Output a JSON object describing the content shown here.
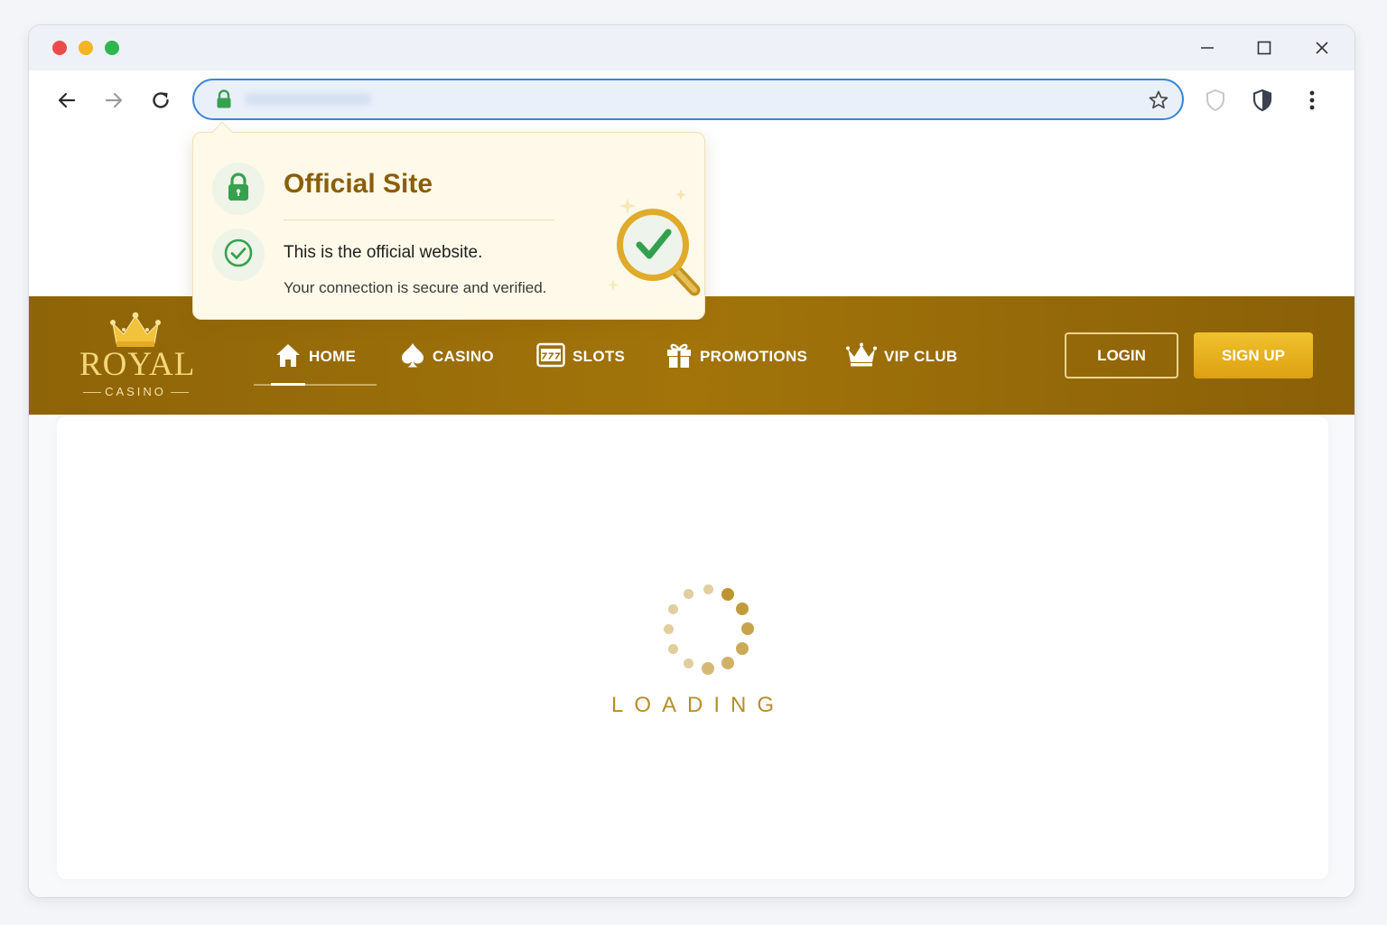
{
  "browser": {
    "controls": {
      "minimize": "minimize-icon",
      "maximize": "maximize-icon",
      "close": "close-icon"
    },
    "toolbar": {
      "back": "back-arrow-icon",
      "forward": "forward-arrow-icon",
      "reload": "reload-icon",
      "bookmark": "star-icon",
      "extension1": "shield-outline-icon",
      "extension2": "shield-half-icon",
      "menu": "kebab-menu-icon"
    },
    "url": {
      "lock": "lock-icon"
    }
  },
  "popup": {
    "title": "Official Site",
    "line1": "This is the official website.",
    "line2": "Your connection is secure and verified."
  },
  "logo": {
    "name": "ROYAL",
    "sub": "CASINO"
  },
  "nav": {
    "items": [
      {
        "label": "HOME",
        "icon": "home-icon"
      },
      {
        "label": "CASINO",
        "icon": "spade-icon"
      },
      {
        "label": "SLOTS",
        "icon": "slot-machine-icon"
      },
      {
        "label": "PROMOTIONS",
        "icon": "gift-icon"
      },
      {
        "label": "VIP CLUB",
        "icon": "crown-icon"
      }
    ],
    "active": "HOME"
  },
  "auth": {
    "login": "LOGIN",
    "signup": "SIGN UP"
  },
  "main": {
    "loading": "LOADING"
  },
  "colors": {
    "gold": "#9a6d09",
    "accent": "#e6ae1a",
    "secure": "#3aa655"
  }
}
